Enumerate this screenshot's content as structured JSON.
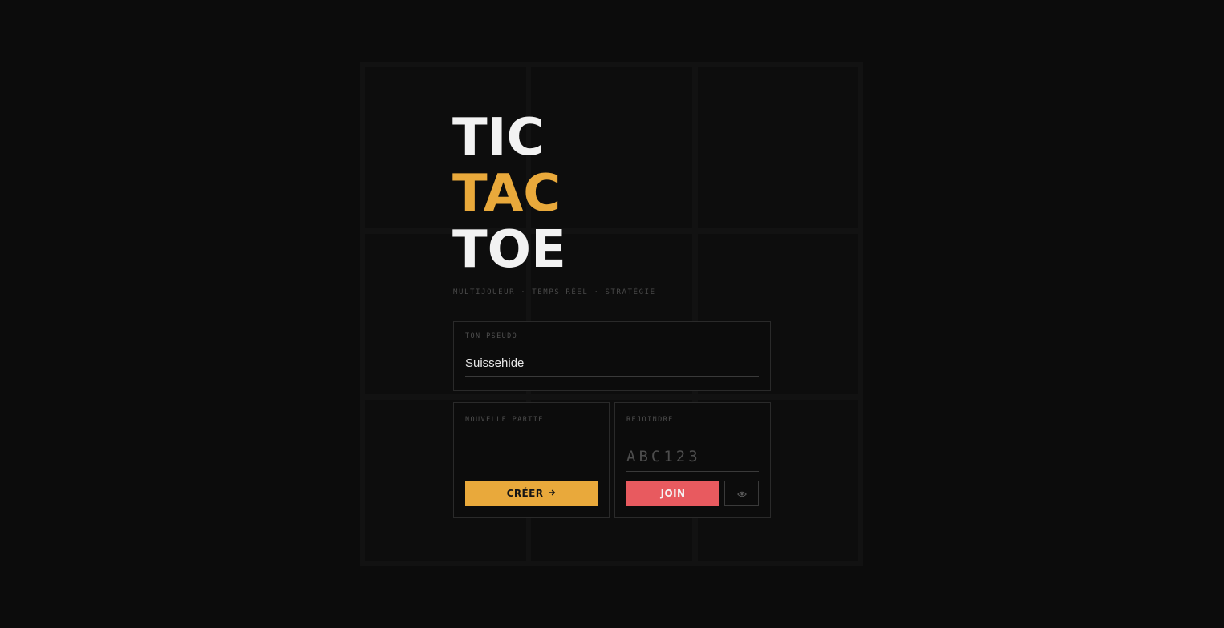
{
  "title": {
    "line1": "TIC",
    "line2": "TAC",
    "line3": "TOE"
  },
  "tagline": "MULTIJOUEUR · TEMPS RÉEL · STRATÉGIE",
  "pseudo": {
    "label": "TON PSEUDO",
    "value": "Suissehide"
  },
  "new_game": {
    "label": "NOUVELLE PARTIE",
    "button_label": "CRÉER",
    "button_icon": "arrow-right-icon"
  },
  "join_game": {
    "label": "REJOINDRE",
    "code_placeholder": "ABC123",
    "button_label": "JOIN",
    "watch_icon": "eye-icon"
  },
  "colors": {
    "accent": "#e9a93b",
    "join": "#e85a5f",
    "background": "#0c0c0c"
  }
}
